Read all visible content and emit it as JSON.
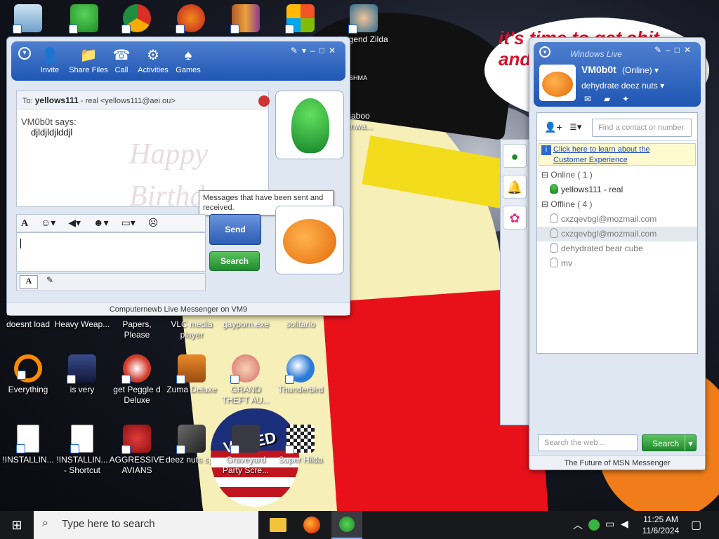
{
  "desktop": {
    "note_text": "it's time to get shit and... or t...",
    "badge_text": "VOTED",
    "icons_top": [
      {
        "label": "",
        "icon": "recycle-bin-icon"
      },
      {
        "label": "",
        "icon": "messenger-icon"
      },
      {
        "label": "",
        "icon": "chrome-icon"
      },
      {
        "label": "",
        "icon": "peggle-icon"
      },
      {
        "label": "",
        "icon": "winrar-icon"
      },
      {
        "label": "",
        "icon": "windows-shield-icon"
      },
      {
        "label": "Legend Zilda",
        "icon": "legend-zilda-icon"
      }
    ],
    "icons_row1": [
      {
        "label": "doesnt load",
        "icon": "app-icon"
      },
      {
        "label": "Heavy Weap...",
        "icon": "app-icon"
      },
      {
        "label": "Papers, Please",
        "icon": "app-icon"
      },
      {
        "label": "VLC media player",
        "icon": "vlc-icon"
      },
      {
        "label": "gayporn.exe",
        "icon": "app-icon"
      },
      {
        "label": "solitario",
        "icon": "app-icon"
      }
    ],
    "icons_row2": [
      {
        "label": "Everything",
        "icon": "everything-search-icon"
      },
      {
        "label": "is very",
        "icon": "shield-icon"
      },
      {
        "label": "get Peggle d Deluxe",
        "icon": "peggle-icon"
      },
      {
        "label": "Zuma Deluxe",
        "icon": "zuma-icon"
      },
      {
        "label": "GRAND THEFT AU...",
        "icon": "gta-icon"
      },
      {
        "label": "Thunderbird",
        "icon": "thunderbird-icon"
      }
    ],
    "icons_row3": [
      {
        "label": "!INSTALLIN...",
        "icon": "document-icon"
      },
      {
        "label": "!INSTALLIN... - Shortcut",
        "icon": "document-icon"
      },
      {
        "label": "AGGRESSIVE AVIANS",
        "icon": "angry-bird-icon"
      },
      {
        "label": "deez nuts spy",
        "icon": "window-stack-icon"
      },
      {
        "label": "Graveyard Party Scre...",
        "icon": "app-icon"
      },
      {
        "label": "Super Hilda",
        "icon": "pixel-icon"
      }
    ],
    "partial_icons": {
      "shma": "SHMA",
      "daboo": "daboo omwa..."
    }
  },
  "conversation": {
    "toolbar": [
      {
        "label": "Invite",
        "icon": "invite-icon"
      },
      {
        "label": "Share Files",
        "icon": "folder-icon"
      },
      {
        "label": "Call",
        "icon": "phone-icon"
      },
      {
        "label": "Activities",
        "icon": "activities-icon"
      },
      {
        "label": "Games",
        "icon": "games-icon"
      }
    ],
    "to_prefix": "To:",
    "to_name": "yellows111",
    "to_detail": "- real <yellows111@aei.ou>",
    "sender_line": "VM0b0t says:",
    "message": "djldjldjlddjl",
    "watermark_line1": "Happy",
    "watermark_line2": "Birthday",
    "tooltip": "Messages that have been sent and received.",
    "send_label": "Send",
    "search_label": "Search",
    "status_bar": "Computernewb Live Messenger on VM9"
  },
  "contacts": {
    "brand": "Windows Live",
    "username": "VM0b0t",
    "status": "(Online)",
    "personal_message": "dehydrate deez nuts",
    "find_placeholder": "Find a contact or number",
    "promo_line1": "Click here to learn about the",
    "promo_line2": "Customer Experience",
    "online_group": "Online ( 1 )",
    "offline_group": "Offline ( 4 )",
    "online_contacts": [
      "yellows111 - real"
    ],
    "offline_contacts": [
      "cxzqevbgl@mozmail.com",
      "cxzqevbgl@mozmail.com",
      "dehydrated bear cube",
      "mv"
    ],
    "web_search_placeholder": "Search the web...",
    "search_button": "Search",
    "footer": "The Future of MSN Messenger"
  },
  "taskbar": {
    "search_placeholder": "Type here to search",
    "time": "11:25 AM",
    "date": "11/6/2024"
  },
  "colors": {
    "msn_blue": "#1f56b4",
    "msn_green": "#1f8a2c",
    "online_green": "#2f9a36"
  }
}
